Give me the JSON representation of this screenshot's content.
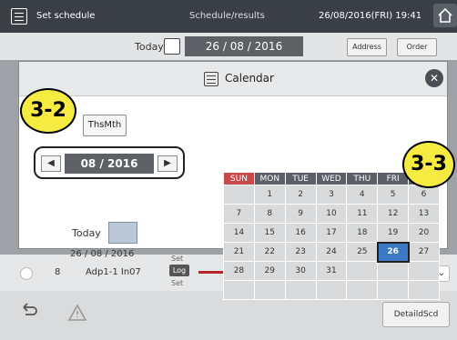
{
  "topbar": {
    "title": "Set schedule",
    "tab": "Schedule/results",
    "datetime": "26/08/2016(FRI) 19:41"
  },
  "datebar": {
    "today_label": "Today",
    "date": "26 / 08 / 2016",
    "address_btn": "Address",
    "order_btn": "Order"
  },
  "row": {
    "num": "8",
    "name": "Adp1-1 In07",
    "set_top": "Set",
    "log": "Log",
    "set_bottom": "Set"
  },
  "bottombar": {
    "detail_btn": "DetaildScd"
  },
  "dialog": {
    "title": "Calendar",
    "thsmth": "ThsMth",
    "month_value": "08 / 2016",
    "today_label": "Today",
    "today_date": "26 / 08 / 2016",
    "callout_left": "3-2",
    "callout_right": "3-3",
    "weekdays": [
      "SUN",
      "MON",
      "TUE",
      "WED",
      "THU",
      "FRI",
      "SAT"
    ],
    "weeks": [
      [
        "",
        "1",
        "2",
        "3",
        "4",
        "5",
        "6"
      ],
      [
        "7",
        "8",
        "9",
        "10",
        "11",
        "12",
        "13"
      ],
      [
        "14",
        "15",
        "16",
        "17",
        "18",
        "19",
        "20"
      ],
      [
        "21",
        "22",
        "23",
        "24",
        "25",
        "26",
        "27"
      ],
      [
        "28",
        "29",
        "30",
        "31",
        "",
        "",
        ""
      ],
      [
        "",
        "",
        "",
        "",
        "",
        "",
        ""
      ]
    ],
    "selected_day": "26"
  },
  "icons": {
    "topbar": "calendar-icon",
    "home": "home-icon",
    "close": "close-icon",
    "prev": "triangle-left-icon",
    "next": "triangle-right-icon",
    "back": "back-arrow-icon",
    "warning": "warning-icon"
  },
  "colors": {
    "accent": "#3b78c5",
    "sunday": "#c8494c",
    "callout": "#f6ec41",
    "header": "#5b6067"
  }
}
